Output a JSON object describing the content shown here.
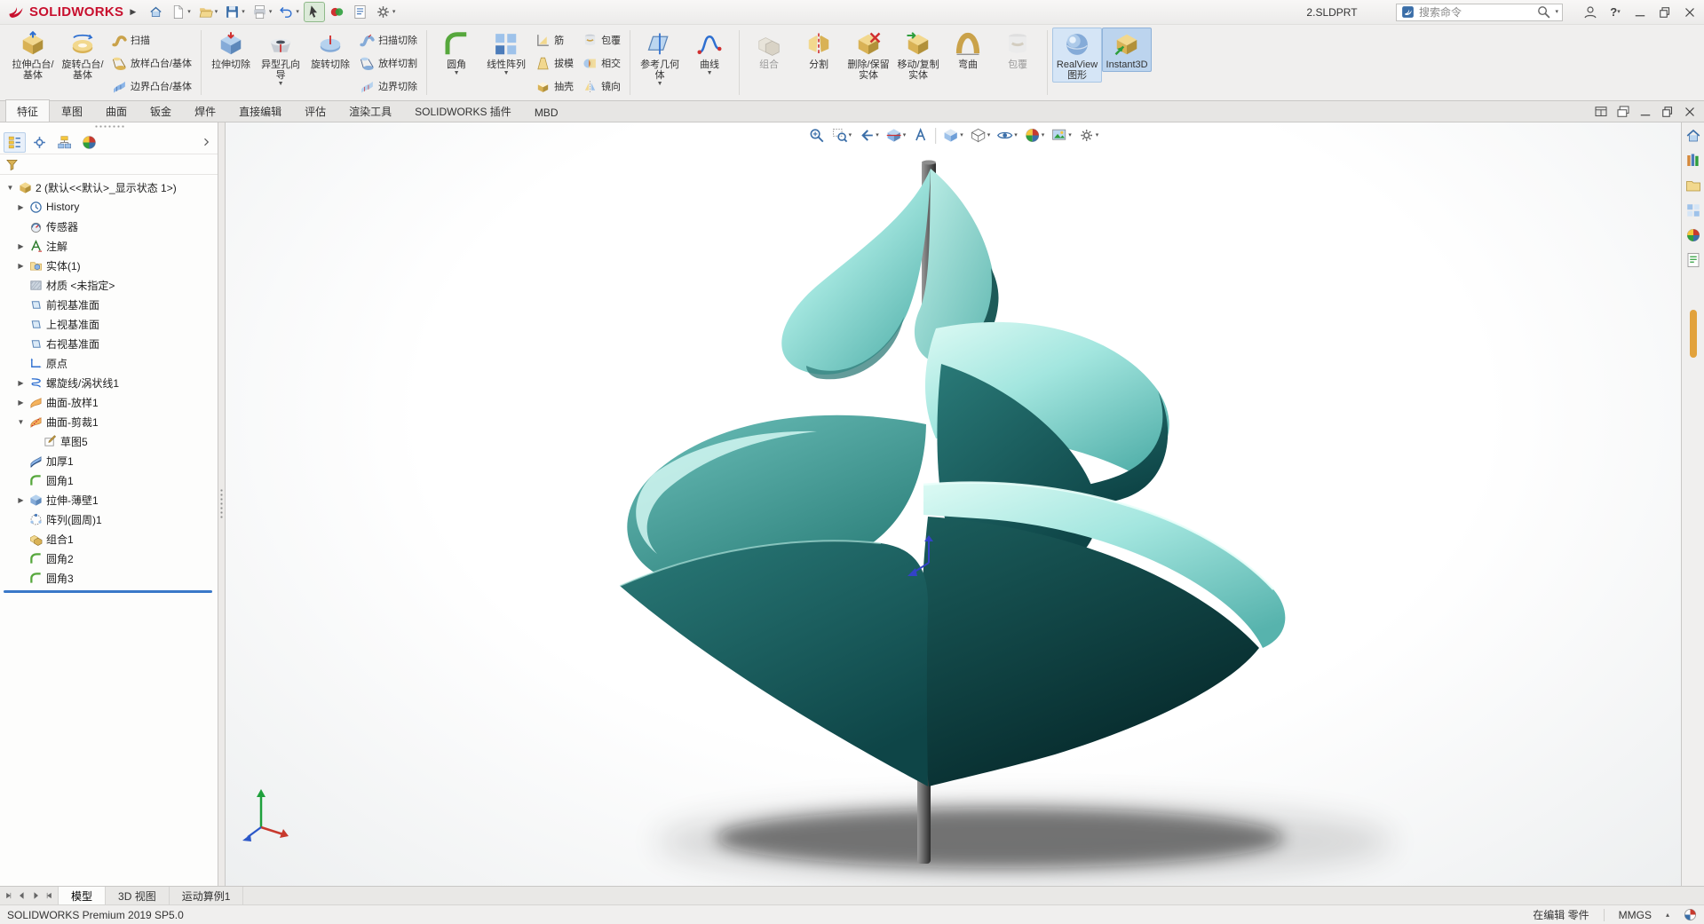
{
  "colors": {
    "accent_blue": "#2a6fc2",
    "ribbon_highlight_bg": "#d5e5f6",
    "logo_red": "#c8102e",
    "rollback_blue": "#3a78c8",
    "model_teal_light": "#a3e6df",
    "model_teal_dark": "#0e4547"
  },
  "titlebar": {
    "logo": "SOLIDWORKS",
    "doc_title": "2.SLDPRT",
    "search": {
      "placeholder": "搜索命令"
    },
    "quick_access": [
      {
        "icon": "home",
        "name": "home",
        "arrow": false
      },
      {
        "icon": "new-document",
        "name": "new-document",
        "arrow": true
      },
      {
        "icon": "open",
        "name": "open",
        "arrow": true
      },
      {
        "icon": "save",
        "name": "save",
        "arrow": true
      },
      {
        "icon": "print",
        "name": "print",
        "arrow": true
      },
      {
        "icon": "undo",
        "name": "undo",
        "arrow": true
      },
      {
        "icon": "select",
        "name": "select",
        "arrow": false,
        "pressed": true
      },
      {
        "icon": "rebuild",
        "name": "rebuild",
        "arrow": false
      },
      {
        "icon": "file-properties",
        "name": "file-properties",
        "arrow": false
      },
      {
        "icon": "options",
        "name": "options",
        "arrow": true
      }
    ],
    "right_icons": [
      "user",
      "help"
    ],
    "window_buttons": [
      "minimize",
      "restore",
      "close"
    ]
  },
  "ribbon": {
    "groups": [
      {
        "big": [
          {
            "label": "拉伸凸台/基体",
            "icon": "extrude-boss",
            "name": "extruded-boss-base"
          },
          {
            "label": "旋转凸台/基体",
            "icon": "revolve-boss",
            "name": "revolved-boss-base"
          }
        ],
        "stacks": [
          [
            {
              "label": "扫描",
              "icon": "sweep",
              "name": "swept-boss-base"
            },
            {
              "label": "放样凸台/基体",
              "icon": "loft",
              "name": "lofted-boss-base"
            },
            {
              "label": "边界凸台/基体",
              "icon": "boundary",
              "name": "boundary-boss-base"
            }
          ]
        ]
      },
      {
        "big": [
          {
            "label": "拉伸切除",
            "icon": "cut-extrude",
            "name": "extruded-cut"
          },
          {
            "label": "异型孔向导",
            "icon": "hole-wizard",
            "name": "hole-wizard",
            "arrow": true
          },
          {
            "label": "旋转切除",
            "icon": "cut-revolve",
            "name": "revolved-cut"
          }
        ],
        "stacks": [
          [
            {
              "label": "扫描切除",
              "icon": "cut-sweep",
              "name": "swept-cut"
            },
            {
              "label": "放样切割",
              "icon": "cut-loft",
              "name": "lofted-cut"
            },
            {
              "label": "边界切除",
              "icon": "cut-boundary",
              "name": "boundary-cut"
            }
          ]
        ]
      },
      {
        "big": [
          {
            "label": "圆角",
            "icon": "fillet",
            "name": "fillet",
            "arrow": true
          },
          {
            "label": "线性阵列",
            "icon": "linear-pattern",
            "name": "linear-pattern",
            "arrow": true
          }
        ],
        "stacks": [
          [
            {
              "label": "筋",
              "icon": "rib",
              "name": "rib"
            },
            {
              "label": "拔模",
              "icon": "draft",
              "name": "draft"
            },
            {
              "label": "抽壳",
              "icon": "shell",
              "name": "shell"
            }
          ],
          [
            {
              "label": "包覆",
              "icon": "wrap",
              "name": "wrap"
            },
            {
              "label": "相交",
              "icon": "intersect",
              "name": "intersect"
            },
            {
              "label": "镜向",
              "icon": "mirror",
              "name": "mirror"
            }
          ]
        ]
      },
      {
        "big": [
          {
            "label": "参考几何体",
            "icon": "reference-geometry",
            "name": "reference-geometry",
            "arrow": true
          },
          {
            "label": "曲线",
            "icon": "curves",
            "name": "curves",
            "arrow": true
          }
        ]
      },
      {
        "big": [
          {
            "label": "组合",
            "icon": "combine",
            "name": "combine",
            "disabled": true
          },
          {
            "label": "分割",
            "icon": "split",
            "name": "split"
          },
          {
            "label": "删除/保留实体",
            "icon": "delete-keep-body",
            "name": "delete-keep-body"
          },
          {
            "label": "移动/复制实体",
            "icon": "move-copy-body",
            "name": "move-copy-body"
          },
          {
            "label": "弯曲",
            "icon": "flex",
            "name": "flex"
          },
          {
            "label": "包覆",
            "icon": "wrap",
            "name": "wrap-2",
            "disabled": true
          }
        ]
      },
      {
        "big": [
          {
            "label": "RealView 图形",
            "icon": "realview",
            "name": "realview-graphics",
            "active": true
          },
          {
            "label": "Instant3D",
            "icon": "instant3d",
            "name": "instant3d",
            "active": true,
            "pressed": true
          }
        ]
      }
    ]
  },
  "command_tabs": {
    "items": [
      {
        "label": "特征",
        "name": "features",
        "active": true
      },
      {
        "label": "草图",
        "name": "sketch"
      },
      {
        "label": "曲面",
        "name": "surfaces"
      },
      {
        "label": "钣金",
        "name": "sheet-metal"
      },
      {
        "label": "焊件",
        "name": "weldments"
      },
      {
        "label": "直接编辑",
        "name": "direct-editing"
      },
      {
        "label": "评估",
        "name": "evaluate"
      },
      {
        "label": "渲染工具",
        "name": "render-tools"
      },
      {
        "label": "SOLIDWORKS 插件",
        "name": "solidworks-add-ins"
      },
      {
        "label": "MBD",
        "name": "mbd"
      }
    ]
  },
  "doc_window_buttons": [
    "window-layout",
    "window-cascade",
    "minimize",
    "restore",
    "close"
  ],
  "view_toolbar": {
    "buttons": [
      {
        "icon": "zoom-fit",
        "name": "zoom-to-fit"
      },
      {
        "icon": "zoom-area",
        "name": "zoom-to-area",
        "arrow": true
      },
      {
        "icon": "previous-view",
        "name": "previous-view",
        "arrow": true
      },
      {
        "icon": "section-view",
        "name": "section-view",
        "arrow": true
      },
      {
        "icon": "annotation-view",
        "name": "dynamic-annotation-views"
      },
      {
        "icon": "view-orientation",
        "name": "view-orientation",
        "arrow": true
      },
      {
        "icon": "display-style",
        "name": "display-style",
        "arrow": true
      },
      {
        "icon": "hide-show",
        "name": "hide-show-items",
        "arrow": true
      },
      {
        "icon": "edit-appearance",
        "name": "edit-appearance",
        "arrow": true
      },
      {
        "icon": "apply-scene",
        "name": "apply-scene",
        "arrow": true
      },
      {
        "icon": "view-settings",
        "name": "view-settings",
        "arrow": true
      }
    ]
  },
  "feature_manager": {
    "panel_tabs": [
      "featuremanager",
      "propertymanager",
      "configurationmanager",
      "displaymanager"
    ],
    "root": "2 (默认<<默认>_显示状态 1>)",
    "items": [
      {
        "label": "History",
        "icon": "history",
        "name": "history",
        "arrow": "right"
      },
      {
        "label": "传感器",
        "icon": "sensors",
        "name": "sensors"
      },
      {
        "label": "注解",
        "icon": "annotations",
        "name": "annotations",
        "arrow": "right"
      },
      {
        "label": "实体(1)",
        "icon": "bodies",
        "name": "solid-bodies",
        "arrow": "right"
      },
      {
        "label": "材质 <未指定>",
        "icon": "material",
        "name": "material"
      },
      {
        "label": "前视基准面",
        "icon": "plane",
        "name": "front-plane"
      },
      {
        "label": "上视基准面",
        "icon": "plane",
        "name": "top-plane"
      },
      {
        "label": "右视基准面",
        "icon": "plane",
        "name": "right-plane"
      },
      {
        "label": "原点",
        "icon": "origin",
        "name": "origin"
      },
      {
        "label": "螺旋线/涡状线1",
        "icon": "helix",
        "name": "helix-spiral1",
        "arrow": "right"
      },
      {
        "label": "曲面-放样1",
        "icon": "surface-loft",
        "name": "surface-loft1",
        "arrow": "right"
      },
      {
        "label": "曲面-剪裁1",
        "icon": "surface-trim",
        "name": "surface-trim1",
        "arrow": "down"
      },
      {
        "label": "草图5",
        "icon": "sketch",
        "name": "sketch5",
        "indent": 1
      },
      {
        "label": "加厚1",
        "icon": "thicken",
        "name": "thicken1"
      },
      {
        "label": "圆角1",
        "icon": "fillet-f",
        "name": "fillet1"
      },
      {
        "label": "拉伸-薄壁1",
        "icon": "extrude-thin",
        "name": "extrude-thin1",
        "arrow": "right"
      },
      {
        "label": "阵列(圆周)1",
        "icon": "circular-pattern",
        "name": "circular-pattern1"
      },
      {
        "label": "组合1",
        "icon": "combine-f",
        "name": "combine1"
      },
      {
        "label": "圆角2",
        "icon": "fillet-f",
        "name": "fillet2"
      },
      {
        "label": "圆角3",
        "icon": "fillet-f",
        "name": "fillet3"
      }
    ]
  },
  "task_pane": {
    "icons": [
      "home-pane",
      "design-library",
      "file-explorer",
      "view-palette",
      "appearances",
      "custom-properties"
    ]
  },
  "bottom_tabs": {
    "items": [
      {
        "label": "模型",
        "name": "model",
        "active": true
      },
      {
        "label": "3D 视图",
        "name": "3d-views"
      },
      {
        "label": "运动算例1",
        "name": "motion-study-1"
      }
    ]
  },
  "statusbar": {
    "app_version": "SOLIDWORKS Premium 2019 SP5.0",
    "mode": "在编辑 零件",
    "units": "MMGS"
  }
}
